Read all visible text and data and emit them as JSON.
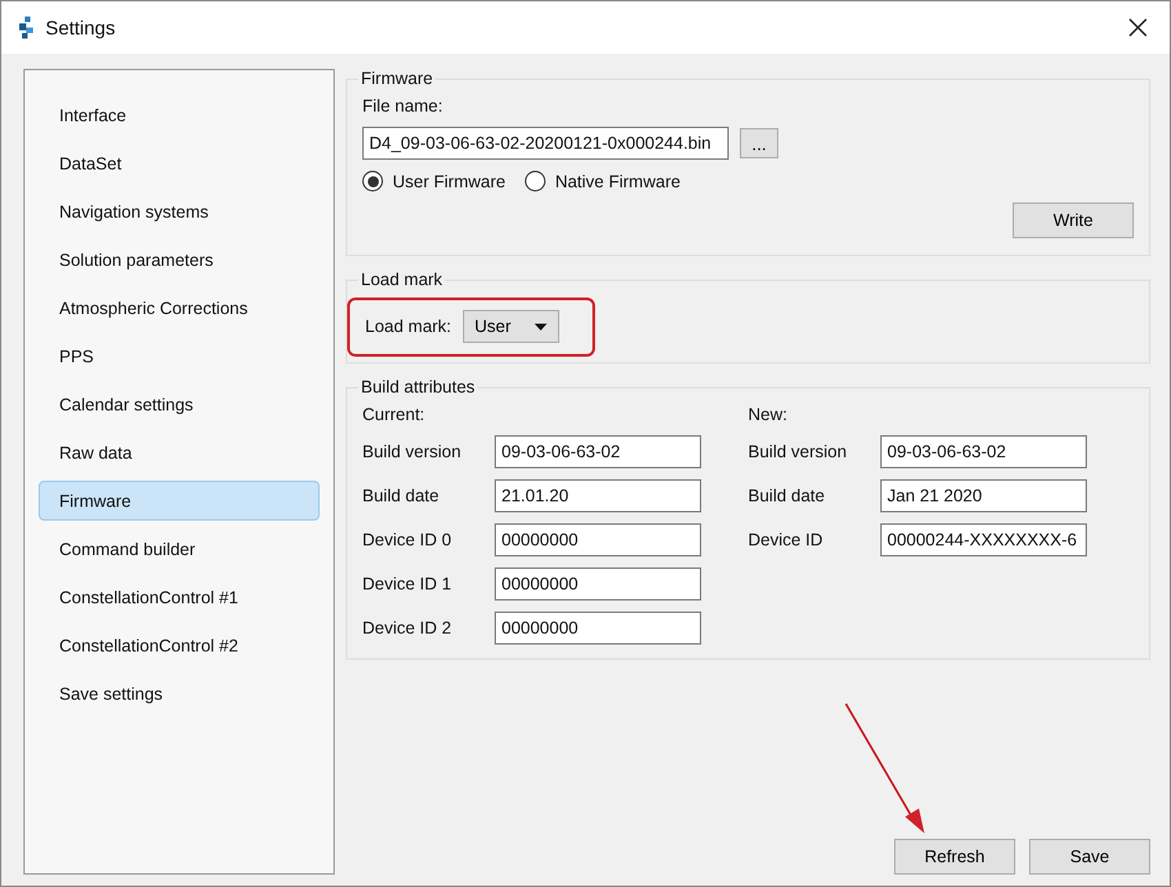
{
  "window": {
    "title": "Settings"
  },
  "sidebar": {
    "items": [
      {
        "label": "Interface",
        "selected": false
      },
      {
        "label": "DataSet",
        "selected": false
      },
      {
        "label": "Navigation systems",
        "selected": false
      },
      {
        "label": "Solution parameters",
        "selected": false
      },
      {
        "label": "Atmospheric Corrections",
        "selected": false
      },
      {
        "label": "PPS",
        "selected": false
      },
      {
        "label": "Calendar settings",
        "selected": false
      },
      {
        "label": "Raw data",
        "selected": false
      },
      {
        "label": "Firmware",
        "selected": true
      },
      {
        "label": "Command builder",
        "selected": false
      },
      {
        "label": "ConstellationControl #1",
        "selected": false
      },
      {
        "label": "ConstellationControl #2",
        "selected": false
      },
      {
        "label": "Save settings",
        "selected": false
      }
    ]
  },
  "firmware": {
    "title": "Firmware",
    "file_label": "File name:",
    "file_value": "D4_09-03-06-63-02-20200121-0x000244.bin",
    "browse": "...",
    "options": [
      {
        "label": "User Firmware",
        "selected": true
      },
      {
        "label": "Native Firmware",
        "selected": false
      }
    ],
    "write": "Write"
  },
  "load_mark": {
    "title": "Load mark",
    "label": "Load mark:",
    "value": "User",
    "highlighted": true
  },
  "build_attributes": {
    "title": "Build attributes",
    "current": {
      "heading": "Current:",
      "fields": [
        {
          "label": "Build version",
          "value": "09-03-06-63-02"
        },
        {
          "label": "Build date",
          "value": "21.01.20"
        },
        {
          "label": "Device ID 0",
          "value": "00000000"
        },
        {
          "label": "Device ID 1",
          "value": "00000000"
        },
        {
          "label": "Device ID 2",
          "value": "00000000"
        }
      ]
    },
    "new": {
      "heading": "New:",
      "fields": [
        {
          "label": "Build version",
          "value": "09-03-06-63-02"
        },
        {
          "label": "Build date",
          "value": "Jan 21 2020"
        },
        {
          "label": "Device ID",
          "value": "00000244-XXXXXXXX-6"
        }
      ]
    }
  },
  "buttons": [
    {
      "label": "Refresh",
      "pointed": true
    },
    {
      "label": "Save",
      "pointed": false
    }
  ]
}
